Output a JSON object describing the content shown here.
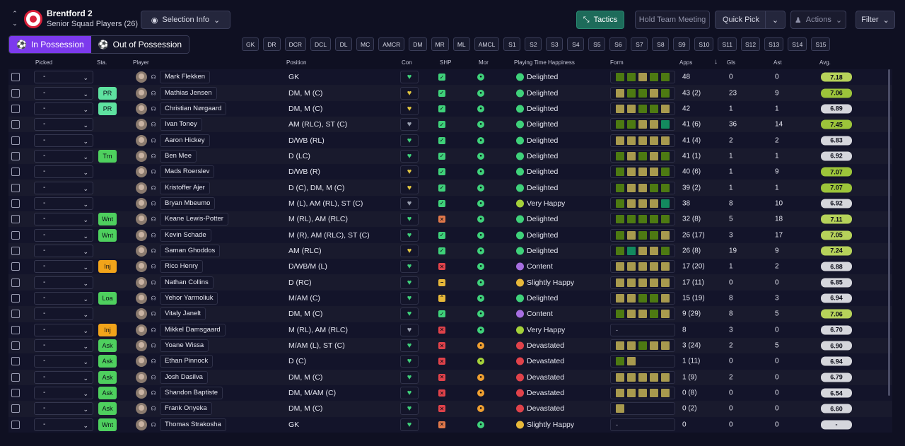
{
  "header": {
    "club": "Brentford 2",
    "squad": "Senior Squad Players (26)",
    "selection_info": "Selection Info",
    "tactics": "Tactics",
    "hold_meeting": "Hold Team Meeting",
    "quick_pick": "Quick Pick",
    "actions": "Actions",
    "filter": "Filter"
  },
  "tabs": {
    "in_possession": "In Possession",
    "out_of_possession": "Out of Possession"
  },
  "positions": [
    "GK",
    "DR",
    "DCR",
    "DCL",
    "DL",
    "MC",
    "AMCR",
    "DM",
    "MR",
    "ML",
    "AMCL",
    "S1",
    "S2",
    "S3",
    "S4",
    "S5",
    "S6",
    "S7",
    "S8",
    "S9",
    "S10",
    "S11",
    "S12",
    "S13",
    "S14",
    "S15"
  ],
  "columns": {
    "picked": "Picked",
    "sta": "Sta.",
    "player": "Player",
    "position": "Position",
    "con": "Con",
    "shp": "SHP",
    "mor": "Mor",
    "pth": "Playing Time Happiness",
    "form": "Form",
    "apps": "Apps",
    "gls": "Gls",
    "ast": "Ast",
    "avg": "Avg."
  },
  "colors": {
    "accent": "#7c3aed",
    "form_dark": "#4d7a12",
    "form_light": "#a89a4e",
    "form_teal": "#138a5e"
  },
  "players": [
    {
      "picked": "-",
      "sta": "",
      "name": "Mark Flekken",
      "position": "GK",
      "con": "green",
      "shp": "tick",
      "mor": "green",
      "pth": "Delighted",
      "form": [
        "d",
        "d",
        "l",
        "d",
        "d"
      ],
      "apps": "48",
      "gls": "0",
      "ast": "0",
      "avg": "7.18",
      "avg_color": "#b6d25a"
    },
    {
      "picked": "-",
      "sta": "PR",
      "name": "Mathias Jensen",
      "position": "DM, M (C)",
      "con": "yellow",
      "shp": "tick",
      "mor": "green",
      "pth": "Delighted",
      "form": [
        "l",
        "d",
        "d",
        "l",
        "d"
      ],
      "apps": "43 (2)",
      "gls": "23",
      "ast": "9",
      "avg": "7.06",
      "avg_color": "#9cc43a"
    },
    {
      "picked": "-",
      "sta": "PR",
      "name": "Christian Nørgaard",
      "position": "DM, M (C)",
      "con": "yellow",
      "shp": "tick",
      "mor": "green",
      "pth": "Delighted",
      "form": [
        "l",
        "l",
        "d",
        "d",
        "l"
      ],
      "apps": "42",
      "gls": "1",
      "ast": "1",
      "avg": "6.89",
      "avg_color": "#d5d6dc"
    },
    {
      "picked": "-",
      "sta": "",
      "name": "Ivan Toney",
      "position": "AM (RLC), ST (C)",
      "con": "grey",
      "shp": "tick",
      "mor": "green",
      "pth": "Delighted",
      "form": [
        "d",
        "d",
        "l",
        "l",
        "t"
      ],
      "apps": "41 (6)",
      "gls": "36",
      "ast": "14",
      "avg": "7.45",
      "avg_color": "#9cc43a"
    },
    {
      "picked": "-",
      "sta": "",
      "name": "Aaron Hickey",
      "position": "D/WB (RL)",
      "con": "green",
      "shp": "tick",
      "mor": "green",
      "pth": "Delighted",
      "form": [
        "l",
        "l",
        "l",
        "l",
        "l"
      ],
      "apps": "41 (4)",
      "gls": "2",
      "ast": "2",
      "avg": "6.83",
      "avg_color": "#d5d6dc"
    },
    {
      "picked": "-",
      "sta": "Trn",
      "name": "Ben Mee",
      "position": "D (LC)",
      "con": "green",
      "shp": "tick",
      "mor": "green",
      "pth": "Delighted",
      "form": [
        "d",
        "l",
        "d",
        "l",
        "d"
      ],
      "apps": "41 (1)",
      "gls": "1",
      "ast": "1",
      "avg": "6.92",
      "avg_color": "#d5d6dc"
    },
    {
      "picked": "-",
      "sta": "",
      "name": "Mads Roerslev",
      "position": "D/WB (R)",
      "con": "yellow",
      "shp": "tick",
      "mor": "green",
      "pth": "Delighted",
      "form": [
        "d",
        "l",
        "l",
        "l",
        "d"
      ],
      "apps": "40 (6)",
      "gls": "1",
      "ast": "9",
      "avg": "7.07",
      "avg_color": "#9cc43a"
    },
    {
      "picked": "-",
      "sta": "",
      "name": "Kristoffer Ajer",
      "position": "D (C), DM, M (C)",
      "con": "yellow",
      "shp": "tick",
      "mor": "green",
      "pth": "Delighted",
      "form": [
        "d",
        "l",
        "l",
        "d",
        "d"
      ],
      "apps": "39 (2)",
      "gls": "1",
      "ast": "1",
      "avg": "7.07",
      "avg_color": "#9cc43a"
    },
    {
      "picked": "-",
      "sta": "",
      "name": "Bryan Mbeumo",
      "position": "M (L), AM (RL), ST (C)",
      "con": "grey",
      "shp": "tick",
      "mor": "green",
      "pth": "Very Happy",
      "form": [
        "d",
        "l",
        "l",
        "l",
        "t"
      ],
      "apps": "38",
      "gls": "8",
      "ast": "10",
      "avg": "6.92",
      "avg_color": "#d5d6dc"
    },
    {
      "picked": "-",
      "sta": "Wnt",
      "name": "Keane Lewis-Potter",
      "position": "M (RL), AM (RLC)",
      "con": "green",
      "shp": "cross-o",
      "mor": "green",
      "pth": "Delighted",
      "form": [
        "d",
        "d",
        "d",
        "d",
        "d"
      ],
      "apps": "32 (8)",
      "gls": "5",
      "ast": "18",
      "avg": "7.11",
      "avg_color": "#b6d25a"
    },
    {
      "picked": "-",
      "sta": "Wnt",
      "name": "Kevin Schade",
      "position": "M (R), AM (RLC), ST (C)",
      "con": "green",
      "shp": "tick",
      "mor": "green",
      "pth": "Delighted",
      "form": [
        "d",
        "l",
        "d",
        "d",
        "l"
      ],
      "apps": "26 (17)",
      "gls": "3",
      "ast": "17",
      "avg": "7.05",
      "avg_color": "#b6d25a"
    },
    {
      "picked": "-",
      "sta": "",
      "name": "Saman Ghoddos",
      "position": "AM (RLC)",
      "con": "yellow",
      "shp": "tick",
      "mor": "green",
      "pth": "Delighted",
      "form": [
        "d",
        "t",
        "l",
        "l",
        "d"
      ],
      "apps": "26 (8)",
      "gls": "19",
      "ast": "9",
      "avg": "7.24",
      "avg_color": "#b6d25a"
    },
    {
      "picked": "-",
      "sta": "Inj",
      "name": "Rico Henry",
      "position": "D/WB/M (L)",
      "con": "green",
      "shp": "cross",
      "mor": "green",
      "pth": "Content",
      "form": [
        "l",
        "l",
        "l",
        "l",
        "l"
      ],
      "apps": "17 (20)",
      "gls": "1",
      "ast": "2",
      "avg": "6.88",
      "avg_color": "#d5d6dc"
    },
    {
      "picked": "-",
      "sta": "",
      "name": "Nathan Collins",
      "position": "D (RC)",
      "con": "green",
      "shp": "minus",
      "mor": "green",
      "pth": "Slightly Happy",
      "form": [
        "l",
        "l",
        "l",
        "l",
        "l"
      ],
      "apps": "17 (11)",
      "gls": "0",
      "ast": "0",
      "avg": "6.85",
      "avg_color": "#d5d6dc"
    },
    {
      "picked": "-",
      "sta": "Loa",
      "name": "Yehor Yarmoliuk",
      "position": "M/AM (C)",
      "con": "green",
      "shp": "up",
      "mor": "green",
      "pth": "Delighted",
      "form": [
        "l",
        "l",
        "d",
        "d",
        "l"
      ],
      "apps": "15 (19)",
      "gls": "8",
      "ast": "3",
      "avg": "6.94",
      "avg_color": "#d5d6dc"
    },
    {
      "picked": "-",
      "sta": "",
      "name": "Vitaly Janelt",
      "position": "DM, M (C)",
      "con": "green",
      "shp": "tick",
      "mor": "green",
      "pth": "Content",
      "form": [
        "d",
        "l",
        "l",
        "d",
        "l"
      ],
      "apps": "9 (29)",
      "gls": "8",
      "ast": "5",
      "avg": "7.06",
      "avg_color": "#b6d25a"
    },
    {
      "picked": "-",
      "sta": "Inj",
      "name": "Mikkel Damsgaard",
      "position": "M (RL), AM (RLC)",
      "con": "grey",
      "shp": "cross",
      "mor": "green",
      "pth": "Very Happy",
      "form": [
        "-"
      ],
      "apps": "8",
      "gls": "3",
      "ast": "0",
      "avg": "6.70",
      "avg_color": "#d5d6dc"
    },
    {
      "picked": "-",
      "sta": "Ask",
      "name": "Yoane Wissa",
      "position": "M/AM (L), ST (C)",
      "con": "green",
      "shp": "cross",
      "mor": "orange",
      "pth": "Devastated",
      "form": [
        "l",
        "l",
        "d",
        "l",
        "l"
      ],
      "apps": "3 (24)",
      "gls": "2",
      "ast": "5",
      "avg": "6.90",
      "avg_color": "#d5d6dc"
    },
    {
      "picked": "-",
      "sta": "Ask",
      "name": "Ethan Pinnock",
      "position": "D (C)",
      "con": "green",
      "shp": "cross",
      "mor": "lime",
      "pth": "Devastated",
      "form": [
        "d",
        "l"
      ],
      "apps": "1 (11)",
      "gls": "0",
      "ast": "0",
      "avg": "6.94",
      "avg_color": "#d5d6dc"
    },
    {
      "picked": "-",
      "sta": "Ask",
      "name": "Josh Dasilva",
      "position": "DM, M (C)",
      "con": "green",
      "shp": "cross",
      "mor": "orange",
      "pth": "Devastated",
      "form": [
        "l",
        "l",
        "l",
        "l",
        "l"
      ],
      "apps": "1 (9)",
      "gls": "2",
      "ast": "0",
      "avg": "6.79",
      "avg_color": "#d5d6dc"
    },
    {
      "picked": "-",
      "sta": "Ask",
      "name": "Shandon Baptiste",
      "position": "DM, M/AM (C)",
      "con": "green",
      "shp": "cross",
      "mor": "orange",
      "pth": "Devastated",
      "form": [
        "l",
        "l",
        "l",
        "l",
        "l"
      ],
      "apps": "0 (8)",
      "gls": "0",
      "ast": "0",
      "avg": "6.54",
      "avg_color": "#d5d6dc"
    },
    {
      "picked": "-",
      "sta": "Ask",
      "name": "Frank Onyeka",
      "position": "DM, M (C)",
      "con": "green",
      "shp": "cross",
      "mor": "orange",
      "pth": "Devastated",
      "form": [
        "l"
      ],
      "apps": "0 (2)",
      "gls": "0",
      "ast": "0",
      "avg": "6.60",
      "avg_color": "#d5d6dc"
    },
    {
      "picked": "-",
      "sta": "Wnt",
      "name": "Thomas Strakosha",
      "position": "GK",
      "con": "green",
      "shp": "cross-o",
      "mor": "green",
      "pth": "Slightly Happy",
      "form": [
        "-"
      ],
      "apps": "0",
      "gls": "0",
      "ast": "0",
      "avg": "-",
      "avg_color": "#d5d6dc"
    }
  ]
}
